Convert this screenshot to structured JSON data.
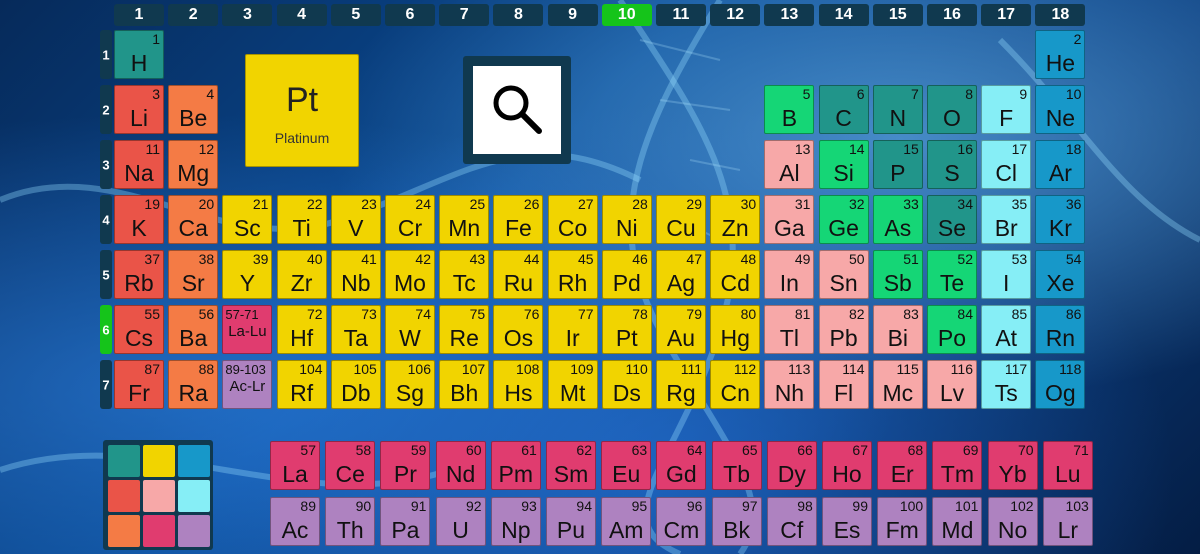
{
  "groups": [
    "1",
    "2",
    "3",
    "4",
    "5",
    "6",
    "7",
    "8",
    "9",
    "10",
    "11",
    "12",
    "13",
    "14",
    "15",
    "16",
    "17",
    "18"
  ],
  "active_group": "10",
  "periods": [
    "1",
    "2",
    "3",
    "4",
    "5",
    "6",
    "7"
  ],
  "active_period": "6",
  "selected_element": {
    "symbol": "Pt",
    "name": "Platinum"
  },
  "search_button": {
    "icon": "search-icon"
  },
  "colors": {
    "teal": "#21958a",
    "red": "#ea5448",
    "orange": "#f47b45",
    "yellow": "#f1d400",
    "pink": "#f7a8a8",
    "green": "#15d676",
    "cyan": "#86eef6",
    "blue": "#1798c9",
    "magenta": "#e03c6f",
    "purple": "#ae82c0",
    "active": "#15c41a",
    "header": "#10394f"
  },
  "palette": [
    "teal",
    "yellow",
    "blue",
    "red",
    "pink",
    "cyan",
    "orange",
    "magenta",
    "purple"
  ],
  "elements": [
    {
      "n": "1",
      "s": "H",
      "g": 1,
      "p": 1,
      "c": "teal"
    },
    {
      "n": "2",
      "s": "He",
      "g": 18,
      "p": 1,
      "c": "blue"
    },
    {
      "n": "3",
      "s": "Li",
      "g": 1,
      "p": 2,
      "c": "red"
    },
    {
      "n": "4",
      "s": "Be",
      "g": 2,
      "p": 2,
      "c": "orange"
    },
    {
      "n": "5",
      "s": "B",
      "g": 13,
      "p": 2,
      "c": "green"
    },
    {
      "n": "6",
      "s": "C",
      "g": 14,
      "p": 2,
      "c": "teal"
    },
    {
      "n": "7",
      "s": "N",
      "g": 15,
      "p": 2,
      "c": "teal"
    },
    {
      "n": "8",
      "s": "O",
      "g": 16,
      "p": 2,
      "c": "teal"
    },
    {
      "n": "9",
      "s": "F",
      "g": 17,
      "p": 2,
      "c": "cyan"
    },
    {
      "n": "10",
      "s": "Ne",
      "g": 18,
      "p": 2,
      "c": "blue"
    },
    {
      "n": "11",
      "s": "Na",
      "g": 1,
      "p": 3,
      "c": "red"
    },
    {
      "n": "12",
      "s": "Mg",
      "g": 2,
      "p": 3,
      "c": "orange"
    },
    {
      "n": "13",
      "s": "Al",
      "g": 13,
      "p": 3,
      "c": "pink"
    },
    {
      "n": "14",
      "s": "Si",
      "g": 14,
      "p": 3,
      "c": "green"
    },
    {
      "n": "15",
      "s": "P",
      "g": 15,
      "p": 3,
      "c": "teal"
    },
    {
      "n": "16",
      "s": "S",
      "g": 16,
      "p": 3,
      "c": "teal"
    },
    {
      "n": "17",
      "s": "Cl",
      "g": 17,
      "p": 3,
      "c": "cyan"
    },
    {
      "n": "18",
      "s": "Ar",
      "g": 18,
      "p": 3,
      "c": "blue"
    },
    {
      "n": "19",
      "s": "K",
      "g": 1,
      "p": 4,
      "c": "red"
    },
    {
      "n": "20",
      "s": "Ca",
      "g": 2,
      "p": 4,
      "c": "orange"
    },
    {
      "n": "21",
      "s": "Sc",
      "g": 3,
      "p": 4,
      "c": "yellow"
    },
    {
      "n": "22",
      "s": "Ti",
      "g": 4,
      "p": 4,
      "c": "yellow"
    },
    {
      "n": "23",
      "s": "V",
      "g": 5,
      "p": 4,
      "c": "yellow"
    },
    {
      "n": "24",
      "s": "Cr",
      "g": 6,
      "p": 4,
      "c": "yellow"
    },
    {
      "n": "25",
      "s": "Mn",
      "g": 7,
      "p": 4,
      "c": "yellow"
    },
    {
      "n": "26",
      "s": "Fe",
      "g": 8,
      "p": 4,
      "c": "yellow"
    },
    {
      "n": "27",
      "s": "Co",
      "g": 9,
      "p": 4,
      "c": "yellow"
    },
    {
      "n": "28",
      "s": "Ni",
      "g": 10,
      "p": 4,
      "c": "yellow"
    },
    {
      "n": "29",
      "s": "Cu",
      "g": 11,
      "p": 4,
      "c": "yellow"
    },
    {
      "n": "30",
      "s": "Zn",
      "g": 12,
      "p": 4,
      "c": "yellow"
    },
    {
      "n": "31",
      "s": "Ga",
      "g": 13,
      "p": 4,
      "c": "pink"
    },
    {
      "n": "32",
      "s": "Ge",
      "g": 14,
      "p": 4,
      "c": "green"
    },
    {
      "n": "33",
      "s": "As",
      "g": 15,
      "p": 4,
      "c": "green"
    },
    {
      "n": "34",
      "s": "Se",
      "g": 16,
      "p": 4,
      "c": "teal"
    },
    {
      "n": "35",
      "s": "Br",
      "g": 17,
      "p": 4,
      "c": "cyan"
    },
    {
      "n": "36",
      "s": "Kr",
      "g": 18,
      "p": 4,
      "c": "blue"
    },
    {
      "n": "37",
      "s": "Rb",
      "g": 1,
      "p": 5,
      "c": "red"
    },
    {
      "n": "38",
      "s": "Sr",
      "g": 2,
      "p": 5,
      "c": "orange"
    },
    {
      "n": "39",
      "s": "Y",
      "g": 3,
      "p": 5,
      "c": "yellow"
    },
    {
      "n": "40",
      "s": "Zr",
      "g": 4,
      "p": 5,
      "c": "yellow"
    },
    {
      "n": "41",
      "s": "Nb",
      "g": 5,
      "p": 5,
      "c": "yellow"
    },
    {
      "n": "42",
      "s": "Mo",
      "g": 6,
      "p": 5,
      "c": "yellow"
    },
    {
      "n": "43",
      "s": "Tc",
      "g": 7,
      "p": 5,
      "c": "yellow"
    },
    {
      "n": "44",
      "s": "Ru",
      "g": 8,
      "p": 5,
      "c": "yellow"
    },
    {
      "n": "45",
      "s": "Rh",
      "g": 9,
      "p": 5,
      "c": "yellow"
    },
    {
      "n": "46",
      "s": "Pd",
      "g": 10,
      "p": 5,
      "c": "yellow"
    },
    {
      "n": "47",
      "s": "Ag",
      "g": 11,
      "p": 5,
      "c": "yellow"
    },
    {
      "n": "48",
      "s": "Cd",
      "g": 12,
      "p": 5,
      "c": "yellow"
    },
    {
      "n": "49",
      "s": "In",
      "g": 13,
      "p": 5,
      "c": "pink"
    },
    {
      "n": "50",
      "s": "Sn",
      "g": 14,
      "p": 5,
      "c": "pink"
    },
    {
      "n": "51",
      "s": "Sb",
      "g": 15,
      "p": 5,
      "c": "green"
    },
    {
      "n": "52",
      "s": "Te",
      "g": 16,
      "p": 5,
      "c": "green"
    },
    {
      "n": "53",
      "s": "I",
      "g": 17,
      "p": 5,
      "c": "cyan"
    },
    {
      "n": "54",
      "s": "Xe",
      "g": 18,
      "p": 5,
      "c": "blue"
    },
    {
      "n": "55",
      "s": "Cs",
      "g": 1,
      "p": 6,
      "c": "red"
    },
    {
      "n": "56",
      "s": "Ba",
      "g": 2,
      "p": 6,
      "c": "orange"
    },
    {
      "n": "57-71",
      "s": "La-Lu",
      "g": 3,
      "p": 6,
      "c": "magenta",
      "small": true
    },
    {
      "n": "72",
      "s": "Hf",
      "g": 4,
      "p": 6,
      "c": "yellow"
    },
    {
      "n": "73",
      "s": "Ta",
      "g": 5,
      "p": 6,
      "c": "yellow"
    },
    {
      "n": "74",
      "s": "W",
      "g": 6,
      "p": 6,
      "c": "yellow"
    },
    {
      "n": "75",
      "s": "Re",
      "g": 7,
      "p": 6,
      "c": "yellow"
    },
    {
      "n": "76",
      "s": "Os",
      "g": 8,
      "p": 6,
      "c": "yellow"
    },
    {
      "n": "77",
      "s": "Ir",
      "g": 9,
      "p": 6,
      "c": "yellow"
    },
    {
      "n": "78",
      "s": "Pt",
      "g": 10,
      "p": 6,
      "c": "yellow"
    },
    {
      "n": "79",
      "s": "Au",
      "g": 11,
      "p": 6,
      "c": "yellow"
    },
    {
      "n": "80",
      "s": "Hg",
      "g": 12,
      "p": 6,
      "c": "yellow"
    },
    {
      "n": "81",
      "s": "Tl",
      "g": 13,
      "p": 6,
      "c": "pink"
    },
    {
      "n": "82",
      "s": "Pb",
      "g": 14,
      "p": 6,
      "c": "pink"
    },
    {
      "n": "83",
      "s": "Bi",
      "g": 15,
      "p": 6,
      "c": "pink"
    },
    {
      "n": "84",
      "s": "Po",
      "g": 16,
      "p": 6,
      "c": "green"
    },
    {
      "n": "85",
      "s": "At",
      "g": 17,
      "p": 6,
      "c": "cyan"
    },
    {
      "n": "86",
      "s": "Rn",
      "g": 18,
      "p": 6,
      "c": "blue"
    },
    {
      "n": "87",
      "s": "Fr",
      "g": 1,
      "p": 7,
      "c": "red"
    },
    {
      "n": "88",
      "s": "Ra",
      "g": 2,
      "p": 7,
      "c": "orange"
    },
    {
      "n": "89-103",
      "s": "Ac-Lr",
      "g": 3,
      "p": 7,
      "c": "purple",
      "small": true
    },
    {
      "n": "104",
      "s": "Rf",
      "g": 4,
      "p": 7,
      "c": "yellow"
    },
    {
      "n": "105",
      "s": "Db",
      "g": 5,
      "p": 7,
      "c": "yellow"
    },
    {
      "n": "106",
      "s": "Sg",
      "g": 6,
      "p": 7,
      "c": "yellow"
    },
    {
      "n": "107",
      "s": "Bh",
      "g": 7,
      "p": 7,
      "c": "yellow"
    },
    {
      "n": "108",
      "s": "Hs",
      "g": 8,
      "p": 7,
      "c": "yellow"
    },
    {
      "n": "109",
      "s": "Mt",
      "g": 9,
      "p": 7,
      "c": "yellow"
    },
    {
      "n": "110",
      "s": "Ds",
      "g": 10,
      "p": 7,
      "c": "yellow"
    },
    {
      "n": "111",
      "s": "Rg",
      "g": 11,
      "p": 7,
      "c": "yellow"
    },
    {
      "n": "112",
      "s": "Cn",
      "g": 12,
      "p": 7,
      "c": "yellow"
    },
    {
      "n": "113",
      "s": "Nh",
      "g": 13,
      "p": 7,
      "c": "pink"
    },
    {
      "n": "114",
      "s": "Fl",
      "g": 14,
      "p": 7,
      "c": "pink"
    },
    {
      "n": "115",
      "s": "Mc",
      "g": 15,
      "p": 7,
      "c": "pink"
    },
    {
      "n": "116",
      "s": "Lv",
      "g": 16,
      "p": 7,
      "c": "pink"
    },
    {
      "n": "117",
      "s": "Ts",
      "g": 17,
      "p": 7,
      "c": "cyan"
    },
    {
      "n": "118",
      "s": "Og",
      "g": 18,
      "p": 7,
      "c": "blue"
    }
  ],
  "lanthanides": [
    {
      "n": "57",
      "s": "La"
    },
    {
      "n": "58",
      "s": "Ce"
    },
    {
      "n": "59",
      "s": "Pr"
    },
    {
      "n": "60",
      "s": "Nd"
    },
    {
      "n": "61",
      "s": "Pm"
    },
    {
      "n": "62",
      "s": "Sm"
    },
    {
      "n": "63",
      "s": "Eu"
    },
    {
      "n": "64",
      "s": "Gd"
    },
    {
      "n": "65",
      "s": "Tb"
    },
    {
      "n": "66",
      "s": "Dy"
    },
    {
      "n": "67",
      "s": "Ho"
    },
    {
      "n": "68",
      "s": "Er"
    },
    {
      "n": "69",
      "s": "Tm"
    },
    {
      "n": "70",
      "s": "Yb"
    },
    {
      "n": "71",
      "s": "Lu"
    }
  ],
  "actinides": [
    {
      "n": "89",
      "s": "Ac"
    },
    {
      "n": "90",
      "s": "Th"
    },
    {
      "n": "91",
      "s": "Pa"
    },
    {
      "n": "92",
      "s": "U"
    },
    {
      "n": "93",
      "s": "Np"
    },
    {
      "n": "94",
      "s": "Pu"
    },
    {
      "n": "95",
      "s": "Am"
    },
    {
      "n": "96",
      "s": "Cm"
    },
    {
      "n": "97",
      "s": "Bk"
    },
    {
      "n": "98",
      "s": "Cf"
    },
    {
      "n": "99",
      "s": "Es"
    },
    {
      "n": "100",
      "s": "Fm"
    },
    {
      "n": "101",
      "s": "Md"
    },
    {
      "n": "102",
      "s": "No"
    },
    {
      "n": "103",
      "s": "Lr"
    }
  ]
}
